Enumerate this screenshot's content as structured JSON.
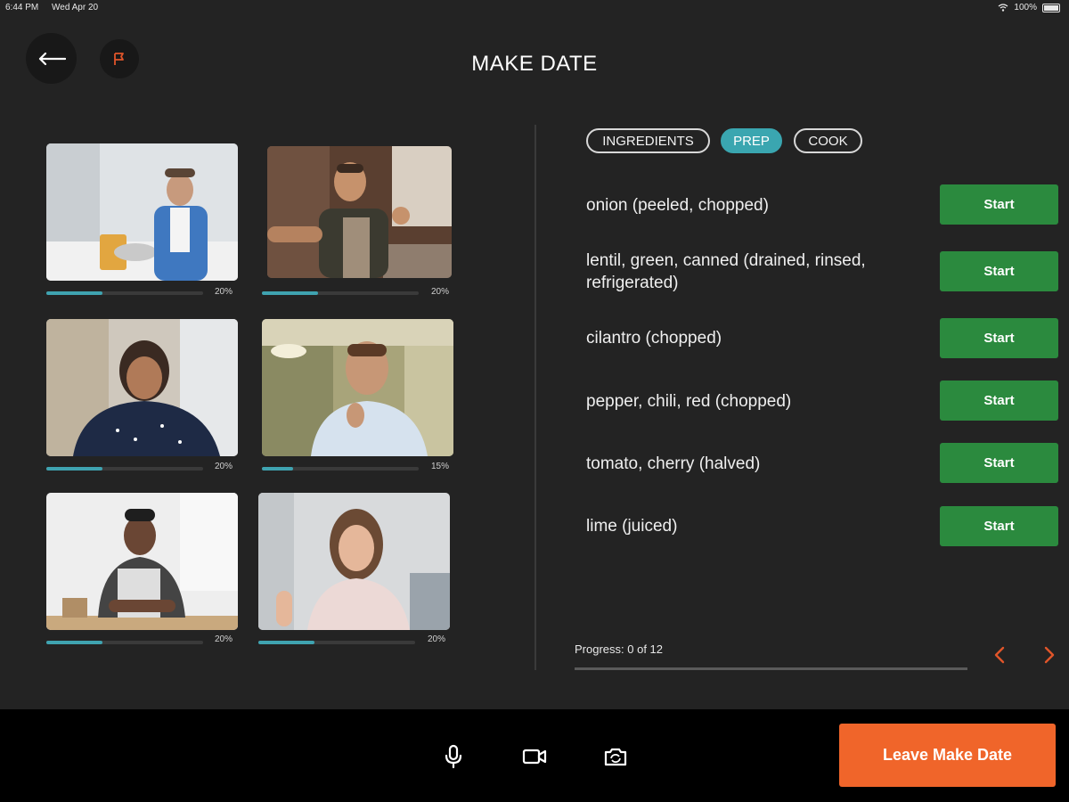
{
  "status_bar": {
    "time": "6:44 PM",
    "date": "Wed Apr 20",
    "battery": "100%"
  },
  "header": {
    "title": "MAKE DATE"
  },
  "participants": [
    {
      "percent_label": "20%",
      "progress": 0.36
    },
    {
      "percent_label": "20%",
      "progress": 0.36
    },
    {
      "percent_label": "20%",
      "progress": 0.36
    },
    {
      "percent_label": "15%",
      "progress": 0.2
    },
    {
      "percent_label": "20%",
      "progress": 0.36
    },
    {
      "percent_label": "20%",
      "progress": 0.36
    }
  ],
  "tabs": [
    {
      "label": "INGREDIENTS",
      "active": false
    },
    {
      "label": "PREP",
      "active": true
    },
    {
      "label": "COOK",
      "active": false
    }
  ],
  "steps": [
    {
      "label": "onion (peeled, chopped)",
      "button": "Start"
    },
    {
      "label": "lentil, green, canned (drained, rinsed, refrigerated)",
      "button": "Start"
    },
    {
      "label": "cilantro (chopped)",
      "button": "Start"
    },
    {
      "label": "pepper, chili, red (chopped)",
      "button": "Start"
    },
    {
      "label": "tomato, cherry (halved)",
      "button": "Start"
    },
    {
      "label": "lime (juiced)",
      "button": "Start"
    }
  ],
  "progress": {
    "text": "Progress: 0 of 12",
    "value": 0
  },
  "footer": {
    "leave_label": "Leave Make Date"
  },
  "colors": {
    "accent": "#3aa6b0",
    "start": "#2b8a3e",
    "leave": "#f0652a",
    "flag": "#e0552a"
  },
  "icons": [
    "back-arrow-icon",
    "flag-icon",
    "microphone-icon",
    "video-camera-icon",
    "flip-camera-icon",
    "chevron-left-icon",
    "chevron-right-icon",
    "wifi-icon",
    "battery-icon"
  ]
}
